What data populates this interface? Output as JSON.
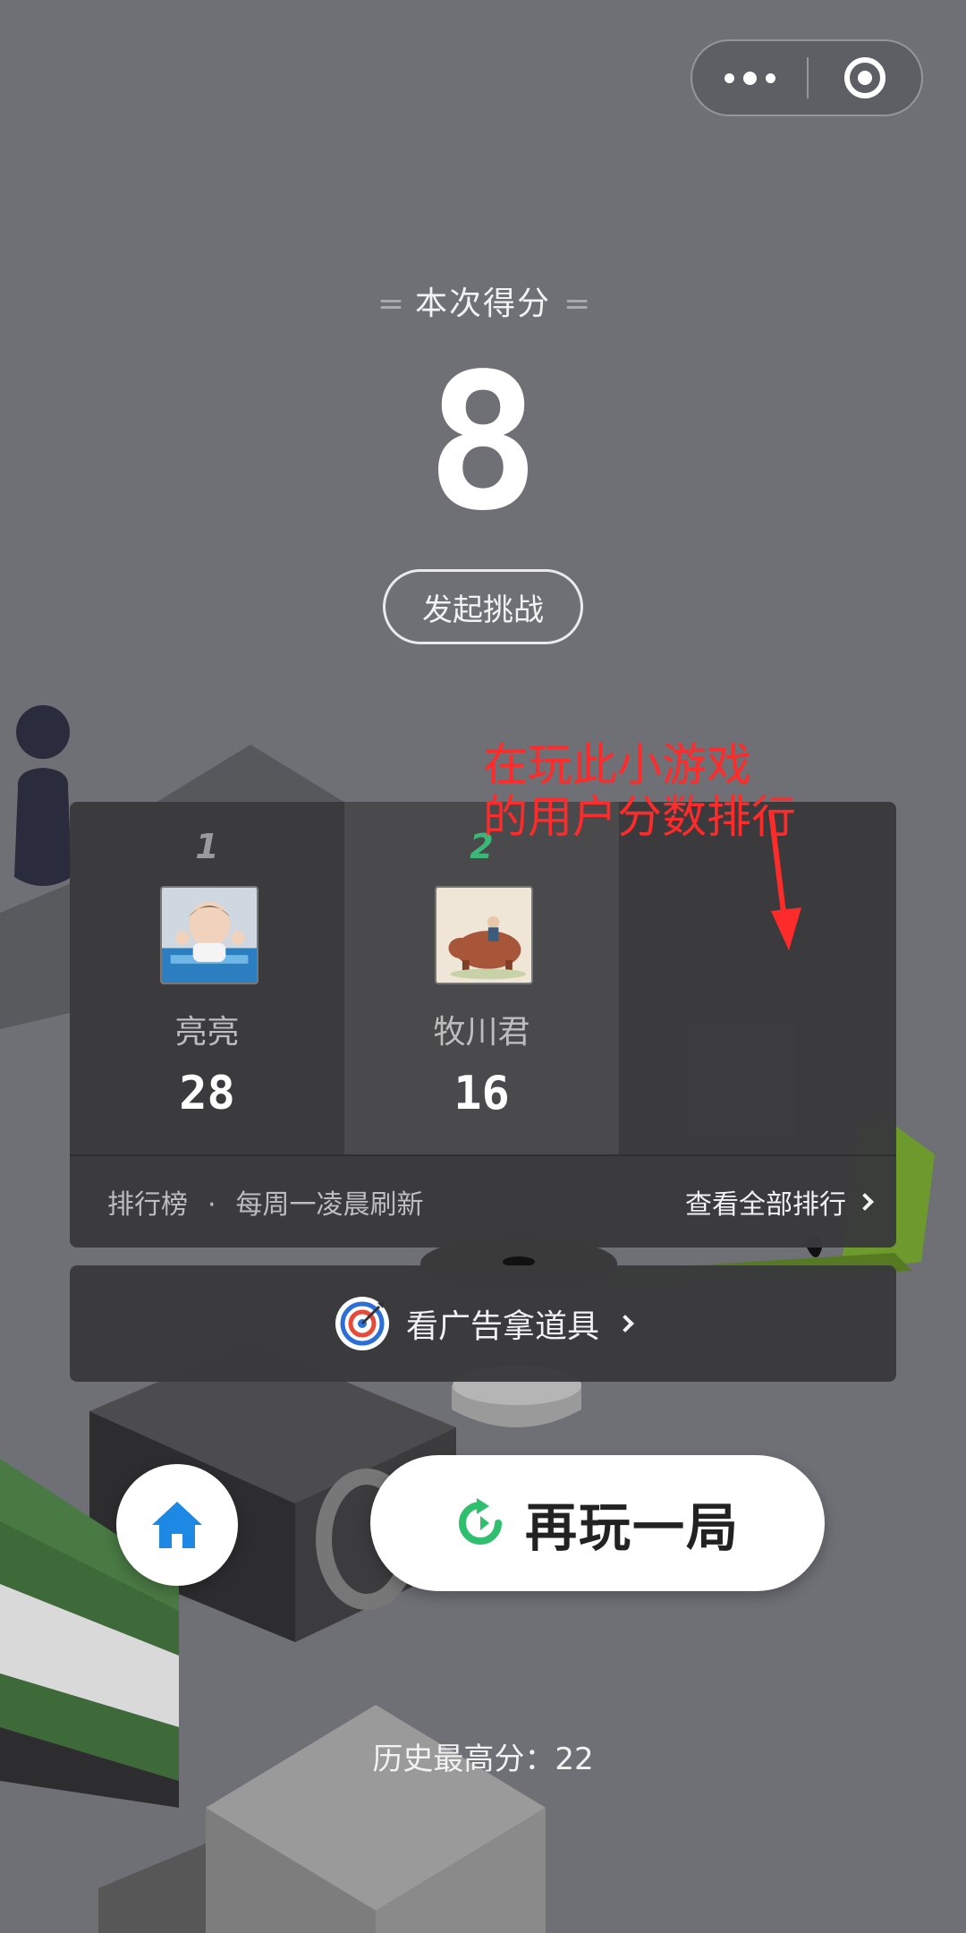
{
  "capsule": {
    "more_icon": "more-dots-icon",
    "close_icon": "target-close-icon"
  },
  "score": {
    "title": "本次得分",
    "title_deco": "=",
    "value": "8"
  },
  "challenge": {
    "label": "发起挑战"
  },
  "ranking": {
    "entries": [
      {
        "rank": "1",
        "name": "亮亮",
        "score": "28"
      },
      {
        "rank": "2",
        "name": "牧川君",
        "score": "16"
      }
    ],
    "footer": {
      "title": "排行榜",
      "separator": "·",
      "refresh_note": "每周一凌晨刷新",
      "view_all": "查看全部排行"
    }
  },
  "ad": {
    "label": "看广告拿道具",
    "icon": "target-dart-icon"
  },
  "home": {
    "icon": "home-icon"
  },
  "replay": {
    "label": "再玩一局",
    "icon": "replay-icon"
  },
  "best": {
    "text": "历史最高分：22"
  },
  "annotation": {
    "line1": "在玩此小游戏",
    "line2": "的用户分数排行"
  },
  "colors": {
    "background": "#6e7076",
    "panel": "#3a3a3c",
    "accent_green": "#2fbf6f",
    "home_blue": "#1e88e5",
    "annotation_red": "#ff2a2a"
  }
}
